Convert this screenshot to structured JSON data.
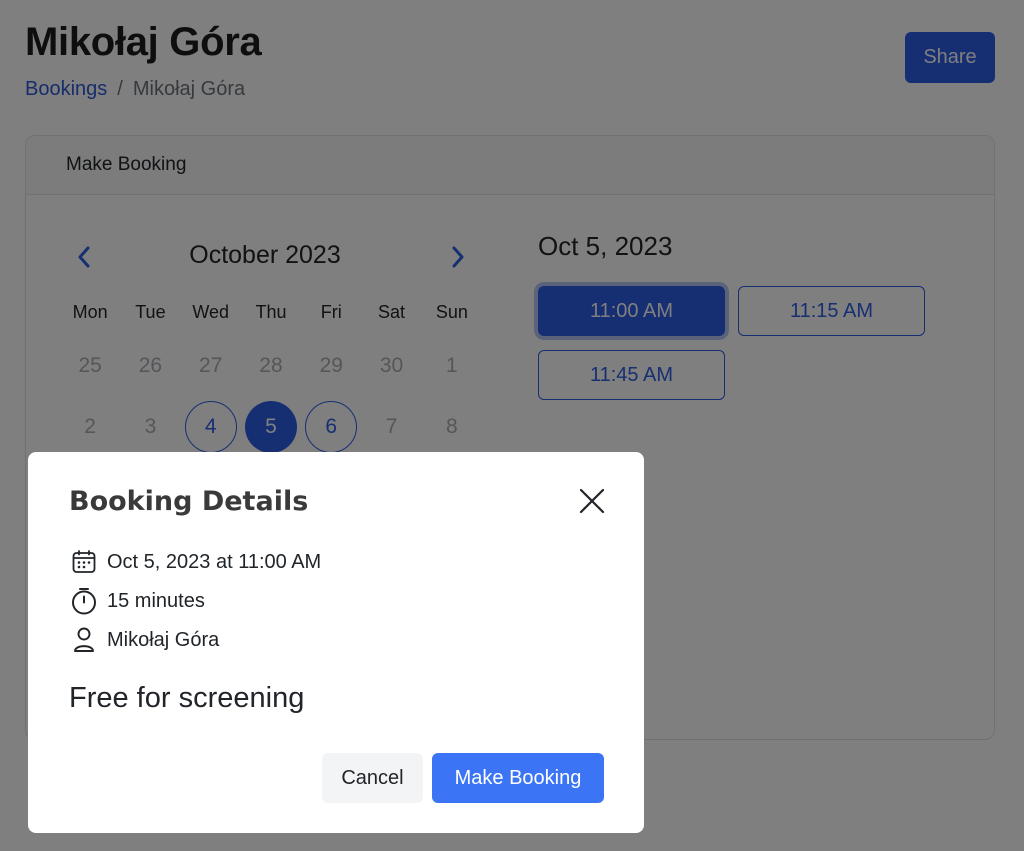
{
  "header": {
    "title": "Mikołaj Góra",
    "breadcrumb": {
      "root": "Bookings",
      "separator": "/",
      "current": "Mikołaj Góra"
    },
    "share_label": "Share"
  },
  "booking_card": {
    "title": "Make Booking",
    "calendar": {
      "month_label": "October 2023",
      "weekdays": [
        "Mon",
        "Tue",
        "Wed",
        "Thu",
        "Fri",
        "Sat",
        "Sun"
      ],
      "weeks": [
        [
          "25",
          "26",
          "27",
          "28",
          "29",
          "30",
          "1"
        ],
        [
          "2",
          "3",
          "4",
          "5",
          "6",
          "7",
          "8"
        ]
      ],
      "available_days": [
        "4",
        "5",
        "6"
      ],
      "selected_day": "5"
    },
    "selected_date": "Oct 5, 2023",
    "time_slots": [
      "11:00 AM",
      "11:15 AM",
      "11:45 AM"
    ],
    "selected_slot": "11:00 AM"
  },
  "modal": {
    "title": "Booking Details",
    "datetime": "Oct 5, 2023 at 11:00 AM",
    "duration": "15 minutes",
    "host": "Mikołaj Góra",
    "event_name": "Free for screening",
    "cancel_label": "Cancel",
    "confirm_label": "Make Booking"
  },
  "colors": {
    "primary": "#2d5fe6",
    "primary_button": "#3b74f5",
    "muted_text": "#a9adb2",
    "overlay": "rgba(0,0,0,0.5)"
  }
}
